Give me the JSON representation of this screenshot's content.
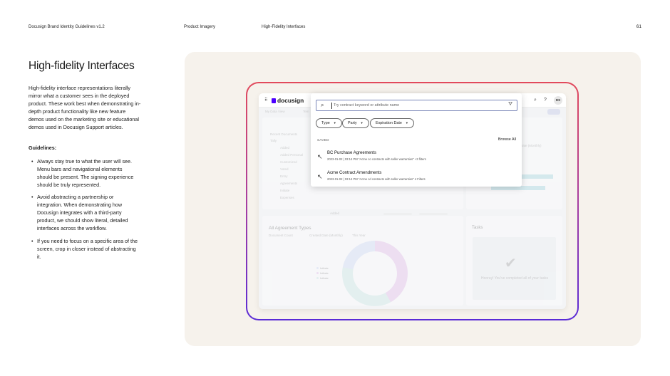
{
  "header": {
    "doc_title": "Docusign Brand Identity Guidelines v1.2",
    "section": "Product Imagery",
    "subsection": "High-Fidelity Interfaces",
    "page_number": "61"
  },
  "content": {
    "title": "High-fidelity Interfaces",
    "intro": "High-fidelity interface representations literally mirror what a customer sees in the deployed product. These work best when demonstrating in-depth product functionality like new feature demos used on the marketing site or educational demos used in Docusign Support articles.",
    "guidelines_label": "Guidelines:",
    "bullets": [
      "Always stay true to what the user will see. Menu bars and navigational elements should be present. The signing experience should be truly represented.",
      "Avoid abstracting a partnership or integration. When demonstrating how Docusign integrates with a third-party product, we should show literal, detailed interfaces across the workflow.",
      "If you need to focus on a specific area of the screen, crop in closer instead of abstracting it."
    ]
  },
  "mockup": {
    "logo": "docusign",
    "avatar": "DS",
    "background": {
      "tabs": [
        "My Data View",
        "Tem"
      ],
      "sidebar": [
        "Recent Documents",
        "Tally",
        "Added",
        "Added Personal",
        "Customized",
        "Voted",
        "Entry",
        "Agreements",
        "Initiate",
        "Expenses"
      ],
      "rows": [
        "Added",
        "Agreements"
      ],
      "bottom_left_title": "All Agreement Types",
      "bottom_left_filter": "Document Count",
      "bottom_left_filter2": "Created Date (Monthly)",
      "bottom_left_filter3": "This Year",
      "legend": [
        "Initiate",
        "Initiate",
        "Initiate"
      ],
      "tasks_title": "Tasks",
      "tasks_empty": "Hooray! You've completed all of your tasks",
      "right_axis_label": "Date (Monthly)"
    },
    "search": {
      "placeholder": "Try contract keyword or attribute name",
      "filters": [
        "Type",
        "Party",
        "Expiration Date"
      ],
      "saved_label": "SAVED",
      "browse_all": "Browse All",
      "items": [
        {
          "title": "BC Purchase Agreements",
          "meta": "2023-01-02 | 03:14 PM    \"Acme co contracts with seller warranties\"   +3 filters"
        },
        {
          "title": "Acme Contract Amendments",
          "meta": "2023-01-02 | 03:14 PM    \"Acme cd contracts with seller warranties\"   4 Filters"
        }
      ]
    }
  },
  "colors": {
    "panel_bg": "#f6f2ec",
    "frame_gradient_top": "#e24a5c",
    "frame_gradient_bottom": "#5a2bd6",
    "brand": "#4c00ff"
  }
}
